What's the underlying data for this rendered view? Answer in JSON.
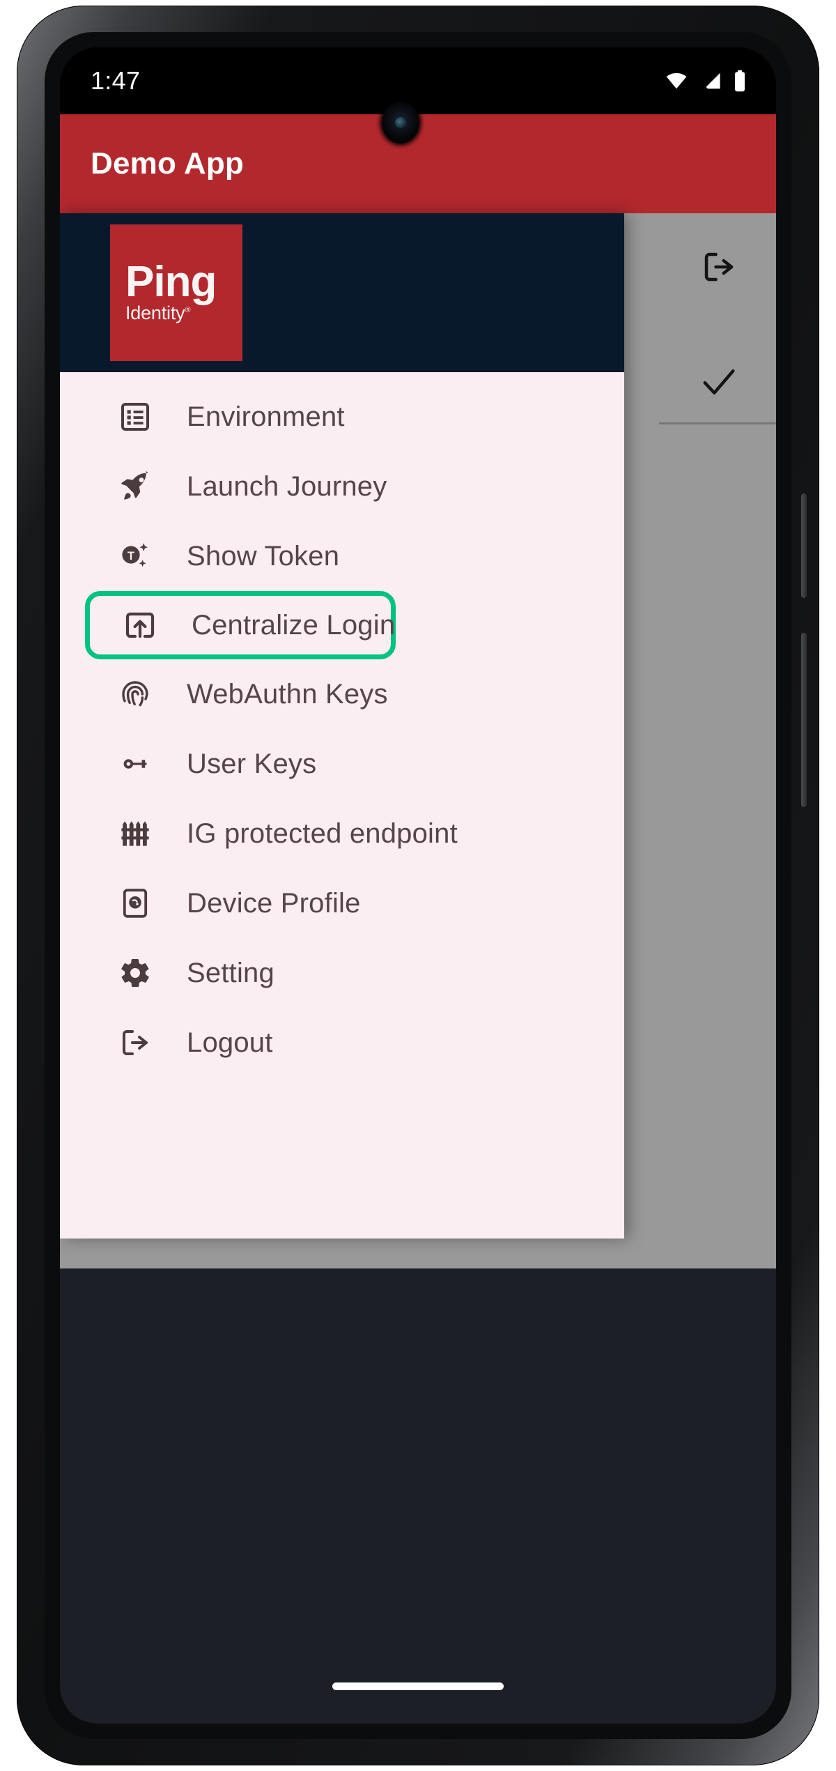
{
  "status_bar": {
    "clock": "1:47",
    "icons": [
      "wifi-icon",
      "cellular-signal-icon",
      "battery-icon"
    ]
  },
  "app_bar": {
    "title": "Demo App",
    "background_color": "#b3282d"
  },
  "drawer": {
    "background_color": "#fbeef2",
    "header": {
      "background_color": "#07192b",
      "logo": {
        "word": "Ping",
        "sub": "Identity",
        "registered_mark": "®",
        "background_color": "#b3282d"
      }
    },
    "items": [
      {
        "label": "Environment",
        "icon": "list-box-icon",
        "highlighted": false
      },
      {
        "label": "Launch Journey",
        "icon": "rocket-icon",
        "highlighted": false
      },
      {
        "label": "Show Token",
        "icon": "token-sparkle-icon",
        "highlighted": false
      },
      {
        "label": "Centralize Login",
        "icon": "open-in-browser-icon",
        "highlighted": true
      },
      {
        "label": "WebAuthn Keys",
        "icon": "fingerprint-icon",
        "highlighted": false
      },
      {
        "label": "User Keys",
        "icon": "key-icon",
        "highlighted": false
      },
      {
        "label": "IG protected endpoint",
        "icon": "fence-icon",
        "highlighted": false
      },
      {
        "label": "Device Profile",
        "icon": "device-profile-icon",
        "highlighted": false
      },
      {
        "label": "Setting",
        "icon": "gear-icon",
        "highlighted": false
      },
      {
        "label": "Logout",
        "icon": "logout-icon",
        "highlighted": false
      }
    ],
    "highlight_color": "#00c281"
  },
  "background_content": {
    "logout_icon": "logout-icon",
    "check_icon": "check-icon",
    "scrim_color": "rgba(110,110,110,0.70)"
  },
  "system_nav": {
    "gesture_pill": "home-gesture-pill"
  }
}
